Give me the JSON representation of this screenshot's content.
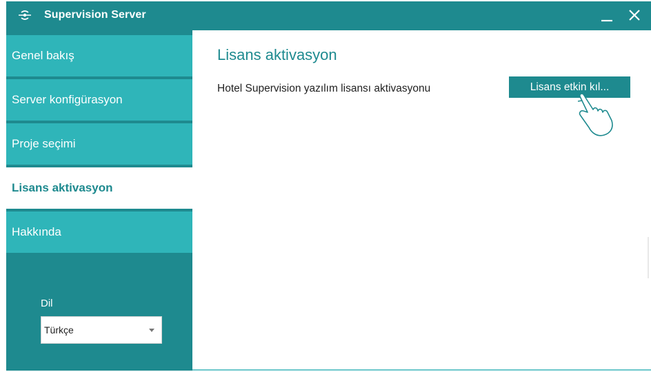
{
  "window": {
    "title": "Supervision Server"
  },
  "sidebar": {
    "items": [
      {
        "label": "Genel bakış",
        "active": false
      },
      {
        "label": "Server konfigürasyon",
        "active": false
      },
      {
        "label": "Proje seçimi",
        "active": false
      },
      {
        "label": "Lisans aktivasyon",
        "active": true
      },
      {
        "label": "Hakkında",
        "active": false
      }
    ],
    "language": {
      "label": "Dil",
      "selected": "Türkçe"
    }
  },
  "main": {
    "title": "Lisans aktivasyon",
    "row_label": "Hotel Supervision yazılım lisansı aktivasyonu",
    "activate_button": "Lisans etkin kıl..."
  },
  "colors": {
    "primary": "#1e8a8f",
    "nav_item": "#2fb5b9",
    "active_bg": "#ffffff"
  },
  "icons": {
    "app": "server-icon",
    "minimize": "minimize-icon",
    "close": "close-icon",
    "dropdown": "chevron-down-icon",
    "pointer": "hand-pointer-icon"
  }
}
